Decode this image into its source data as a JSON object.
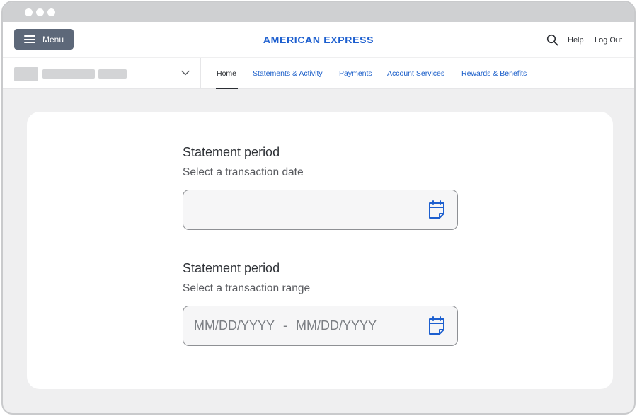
{
  "header": {
    "menu_label": "Menu",
    "brand": "AMERICAN EXPRESS",
    "help_label": "Help",
    "logout_label": "Log Out"
  },
  "nav": {
    "tabs": [
      {
        "label": "Home",
        "active": true
      },
      {
        "label": "Statements & Activity"
      },
      {
        "label": "Payments"
      },
      {
        "label": "Account Services"
      },
      {
        "label": "Rewards & Benefits"
      }
    ]
  },
  "form": {
    "single": {
      "title": "Statement period",
      "subtitle": "Select a transaction date",
      "value": ""
    },
    "range": {
      "title": "Statement period",
      "subtitle": "Select a transaction range",
      "start_placeholder": "MM/DD/YYYY",
      "separator": "-",
      "end_placeholder": "MM/DD/YYYY"
    }
  },
  "icons": {
    "search": "search-icon",
    "chevron": "chevron-down-icon",
    "calendar": "calendar-icon",
    "menu": "hamburger-icon"
  },
  "colors": {
    "brand_blue": "#1d5fcf",
    "link_blue": "#1a5ec9",
    "menu_button": "#5d6879",
    "background": "#efeff0"
  }
}
